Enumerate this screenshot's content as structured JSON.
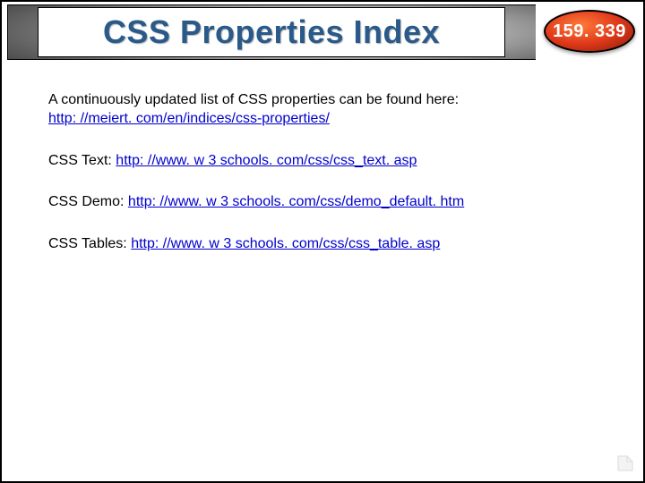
{
  "header": {
    "title": "CSS Properties Index"
  },
  "badge": {
    "value": "159. 339"
  },
  "content": {
    "intro_text": "A continuously updated list of CSS properties can be found here:",
    "intro_link": "http: //meiert. com/en/indices/css-properties/",
    "items": [
      {
        "label": "CSS Text: ",
        "url": "http: //www. w 3 schools. com/css/css_text. asp"
      },
      {
        "label": "CSS Demo: ",
        "url": "http: //www. w 3 schools. com/css/demo_default. htm"
      },
      {
        "label": "CSS Tables: ",
        "url": "http: //www. w 3 schools. com/css/css_table. asp"
      }
    ]
  }
}
